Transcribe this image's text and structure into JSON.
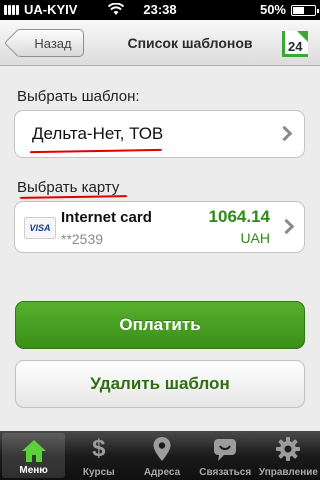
{
  "status_bar": {
    "carrier": "UA-KYIV",
    "time": "23:38",
    "battery": "50%"
  },
  "navbar": {
    "back_label": "Назад",
    "title": "Список шаблонов",
    "logo_text": "24"
  },
  "form": {
    "template_label": "Выбрать шаблон:",
    "template_value": "Дельта-Нет, ТОВ",
    "card_label": "Выбрать карту"
  },
  "card": {
    "brand": "VISA",
    "name": "Internet card",
    "number": "**2539",
    "amount": "1064.14",
    "currency": "UAH"
  },
  "buttons": {
    "pay": "Оплатить",
    "delete": "Удалить шаблон"
  },
  "tabbar": {
    "items": [
      {
        "label": "Меню",
        "icon": "home-icon",
        "active": true
      },
      {
        "label": "Курсы",
        "icon": "dollar-icon",
        "active": false
      },
      {
        "label": "Адреса",
        "icon": "map-pin-icon",
        "active": false
      },
      {
        "label": "Связаться",
        "icon": "chat-icon",
        "active": false
      },
      {
        "label": "Управление",
        "icon": "gear-icon",
        "active": false
      }
    ]
  },
  "colors": {
    "accent_green": "#3aa834",
    "amount_green": "#2e8b18",
    "annotation_red": "#e00000"
  }
}
